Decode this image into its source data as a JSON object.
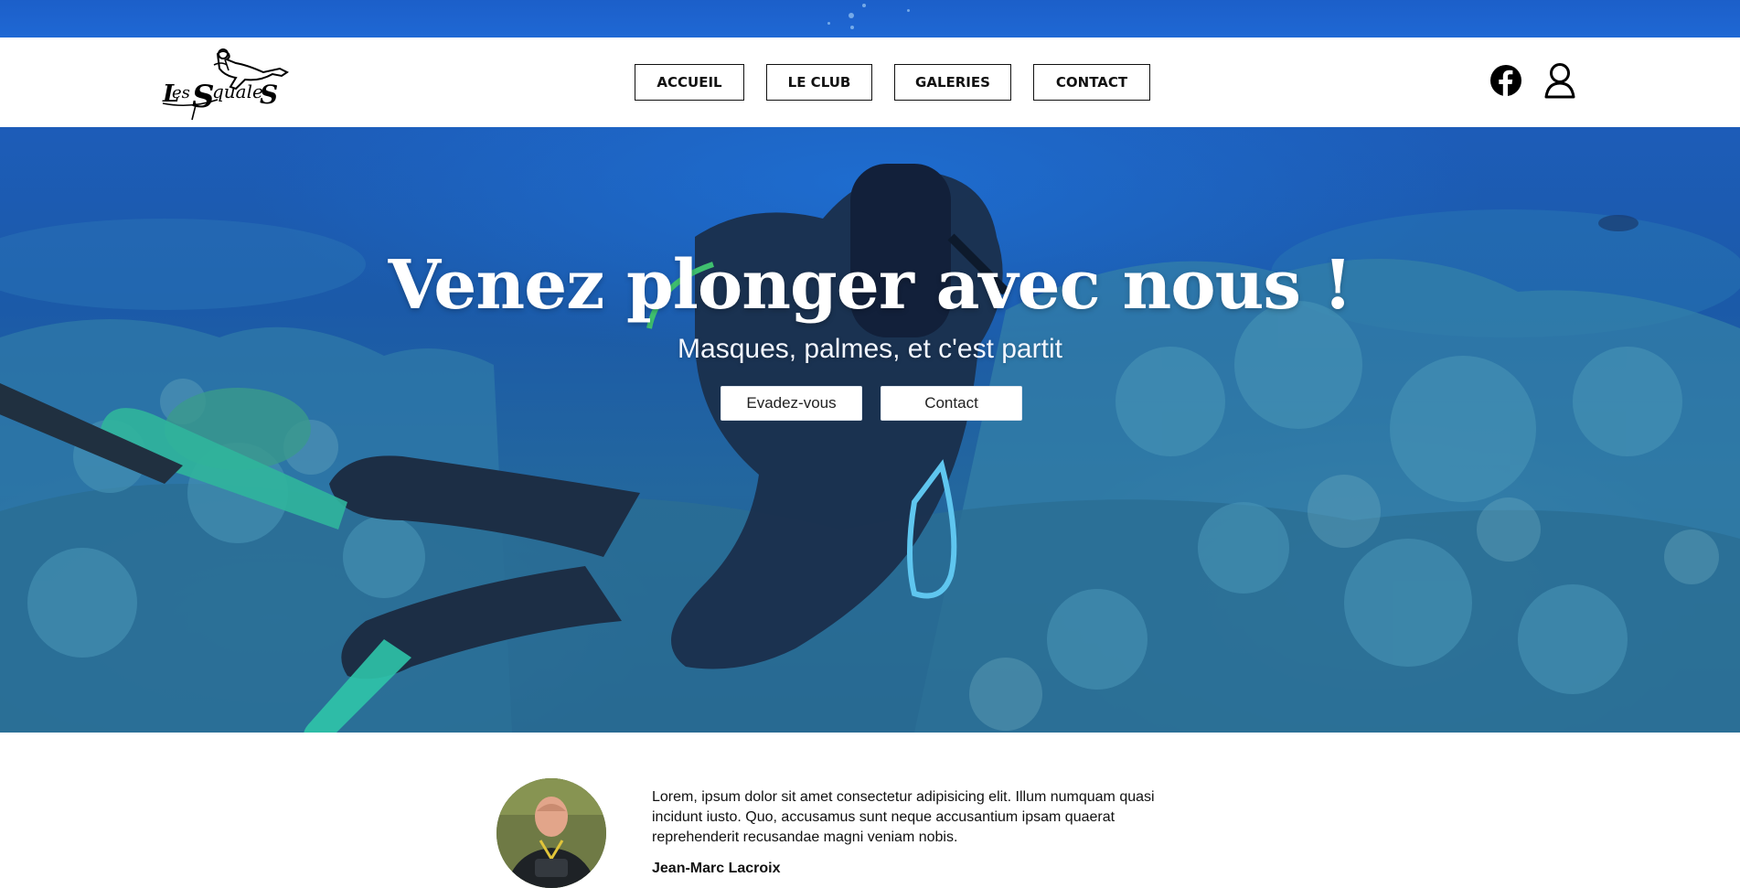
{
  "header": {
    "logo_alt": "Les Squales",
    "nav": [
      {
        "label": "ACCUEIL"
      },
      {
        "label": "LE CLUB"
      },
      {
        "label": "GALERIES"
      },
      {
        "label": "CONTACT"
      }
    ],
    "icons": [
      "facebook-icon",
      "user-icon"
    ]
  },
  "hero": {
    "title": "Venez plonger avec nous !",
    "subtitle": "Masques, palmes, et c'est partit",
    "buttons": {
      "primary": "Evadez-vous",
      "secondary": "Contact"
    }
  },
  "about": {
    "text": "Lorem, ipsum dolor sit amet consectetur adipisicing elit. Illum numquam quasi incidunt iusto. Quo, accusamus sunt neque accusantium ipsam quaerat reprehenderit recusandae magni veniam nobis.",
    "name": "Jean-Marc Lacroix"
  },
  "colors": {
    "strip": "#1f68d4",
    "hero_water": "#1d5cb8",
    "nav_border": "#111111"
  }
}
